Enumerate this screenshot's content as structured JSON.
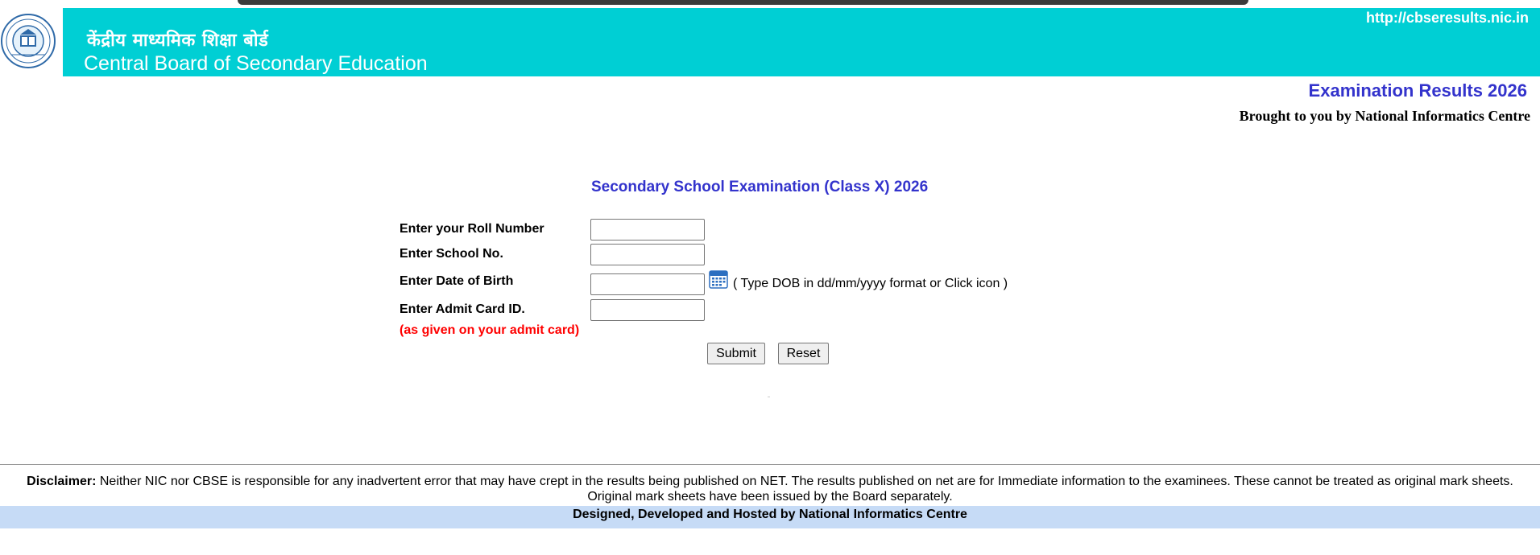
{
  "header": {
    "hindi_title": "केंद्रीय माध्यमिक शिक्षा बोर्ड",
    "english_title": "Central Board of Secondary Education",
    "site_url": "http://cbseresults.nic.in",
    "banner_color": "#00cfd4",
    "logo_icon": "cbse-emblem-icon"
  },
  "titles": {
    "exam_results": "Examination Results 2026",
    "brought_by": "Brought to you by National Informatics Centre"
  },
  "form": {
    "heading": "Secondary School Examination (Class X) 2026",
    "roll_label": "Enter your Roll Number",
    "roll_value": "",
    "school_label": "Enter School No.",
    "school_value": "",
    "dob_label": "Enter Date of Birth",
    "dob_value": "",
    "dob_icon": "calendar-icon",
    "dob_hint": "( Type DOB in dd/mm/yyyy format or Click icon )",
    "admit_label": "Enter Admit Card ID.",
    "admit_value": "",
    "admit_note": "(as given on your admit card)",
    "submit_label": "Submit",
    "reset_label": "Reset"
  },
  "footer": {
    "disclaimer_label": "Disclaimer:",
    "disclaimer_line1": "Neither NIC nor CBSE is responsible for any inadvertent error that may have crept in the results being published on NET. The results published on net are for Immediate information to the examinees. These cannot be treated as original mark sheets.",
    "disclaimer_line2": "Original mark sheets have been issued by the Board separately.",
    "credit": "Designed, Developed and Hosted by National Informatics Centre"
  },
  "colors": {
    "accent": "#3333cc",
    "warning": "#ff0000",
    "footer_bg": "#c6dbf6"
  }
}
